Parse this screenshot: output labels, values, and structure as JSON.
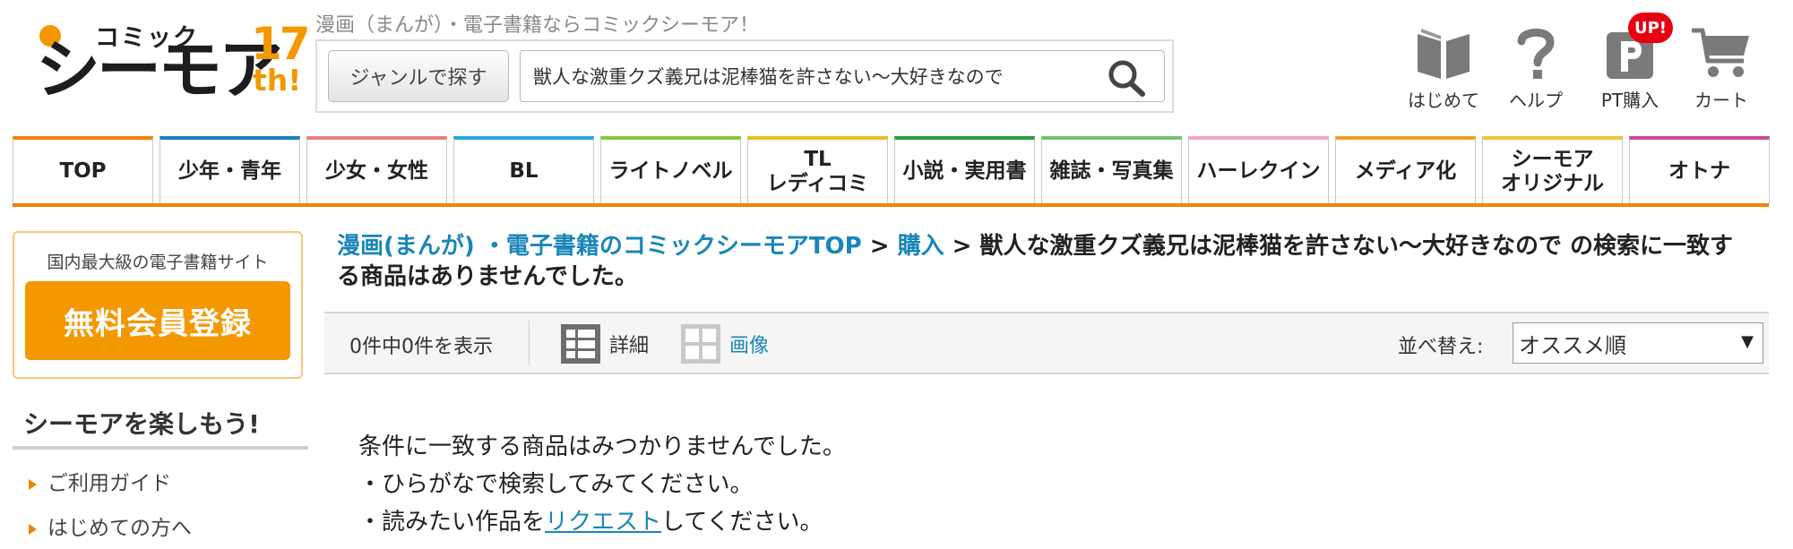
{
  "header": {
    "logo": {
      "small": "コミック",
      "big": "シーモア",
      "num": "17",
      "suffix": "th!"
    },
    "tagline": "漫画（まんが）・電子書籍ならコミックシーモア！",
    "genre_button": "ジャンルで探す",
    "search_value": "獣人な激重クズ義兄は泥棒猫を許さない～大好きなので",
    "icons": [
      {
        "name": "book-icon",
        "label": "はじめて"
      },
      {
        "name": "question-icon",
        "label": "ヘルプ"
      },
      {
        "name": "points-icon",
        "label": "PT購入",
        "badge": "UP!"
      },
      {
        "name": "cart-icon",
        "label": "カート"
      }
    ]
  },
  "nav": {
    "tabs": [
      {
        "label": "TOP",
        "color": "#f08300"
      },
      {
        "label": "少年・青年",
        "color": "#1f7ec2"
      },
      {
        "label": "少女・女性",
        "color": "#e98080"
      },
      {
        "label": "BL",
        "color": "#29a8d8"
      },
      {
        "label": "ライトノベル",
        "color": "#8cc63f"
      },
      {
        "label": "TL\nレディコミ",
        "color": "#e8c020"
      },
      {
        "label": "小説・実用書",
        "color": "#2e9a3c"
      },
      {
        "label": "雑誌・写真集",
        "color": "#72c26e"
      },
      {
        "label": "ハーレクイン",
        "color": "#f2a6c8"
      },
      {
        "label": "メディア化",
        "color": "#f0a028"
      },
      {
        "label": "シーモア\nオリジナル",
        "color": "#f2c437"
      },
      {
        "label": "オトナ",
        "color": "#c94a96"
      }
    ],
    "accent": "#f08300"
  },
  "sidebar": {
    "caption": "国内最大級の電子書籍サイト",
    "register": "無料会員登録",
    "enjoy_title": "シーモアを楽しもう!",
    "links": [
      "ご利用ガイド",
      "はじめての方へ"
    ]
  },
  "breadcrumb": {
    "home": "漫画(まんが) ・電子書籍のコミックシーモアTOP",
    "sep": " > ",
    "purchase": "購入",
    "rest": "獣人な激重クズ義兄は泥棒猫を許さない～大好きなので の検索に一致する商品はありませんでした。"
  },
  "toolbar": {
    "count": "0件中0件を表示",
    "detail": "詳細",
    "image": "画像",
    "sort_label": "並べ替え:",
    "sort_value": "オススメ順"
  },
  "message": {
    "line1": "条件に一致する商品はみつかりませんでした。",
    "line2": "・ひらがなで検索してみてください。",
    "line3_pre": "・読みたい作品を",
    "line3_link": "リクエスト",
    "line3_post": "してください。"
  },
  "colors": {
    "accent": "#f39800",
    "link": "#1a86b8",
    "badge": "#e60012"
  }
}
